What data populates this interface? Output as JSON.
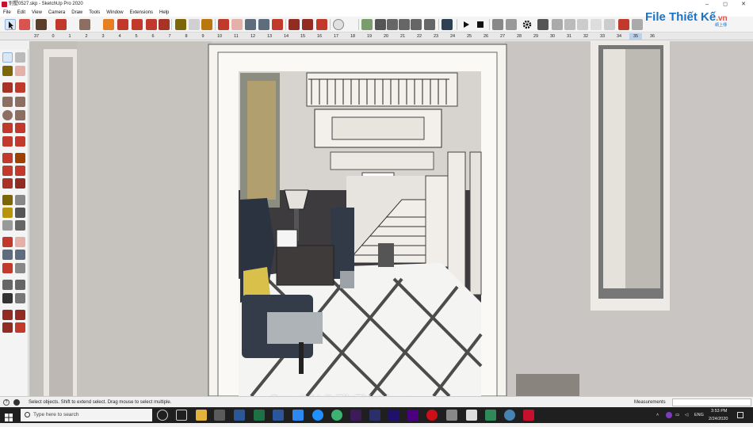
{
  "window": {
    "title": "别墅0527.skp - SketchUp Pro 2020",
    "controls": [
      "–",
      "◻",
      "✕"
    ]
  },
  "menu": [
    "File",
    "Edit",
    "View",
    "Camera",
    "Draw",
    "Tools",
    "Window",
    "Extensions",
    "Help"
  ],
  "ruler": {
    "ticks": [
      "37",
      "0",
      "1",
      "2",
      "3",
      "4",
      "5",
      "6",
      "7",
      "8",
      "9",
      "10",
      "11",
      "12",
      "13",
      "14",
      "15",
      "16",
      "17",
      "18",
      "19",
      "20",
      "21",
      "22",
      "23",
      "24",
      "25",
      "26",
      "27",
      "28",
      "29",
      "30",
      "31",
      "32",
      "33",
      "34",
      "35",
      "36"
    ],
    "active": "35"
  },
  "brand": {
    "logo_main": "File Thiết Kế",
    "logo_suffix": ".vn",
    "logo_tag": "網上傳",
    "watermark": "Copyright © FileThietKe.vn"
  },
  "status": {
    "hint": "Select objects. Shift to extend select. Drag mouse to select multiple.",
    "measurements_label": "Measurements"
  },
  "taskbar": {
    "search_placeholder": "Type here to search",
    "time": "3:53 PM",
    "date": "2/24/2020",
    "lang": "ENG"
  },
  "colors": {
    "accent": "#1a73c9",
    "taskbar": "#1f1f1f",
    "wall": "#c9c6c4",
    "trim": "#f4f2ee"
  }
}
